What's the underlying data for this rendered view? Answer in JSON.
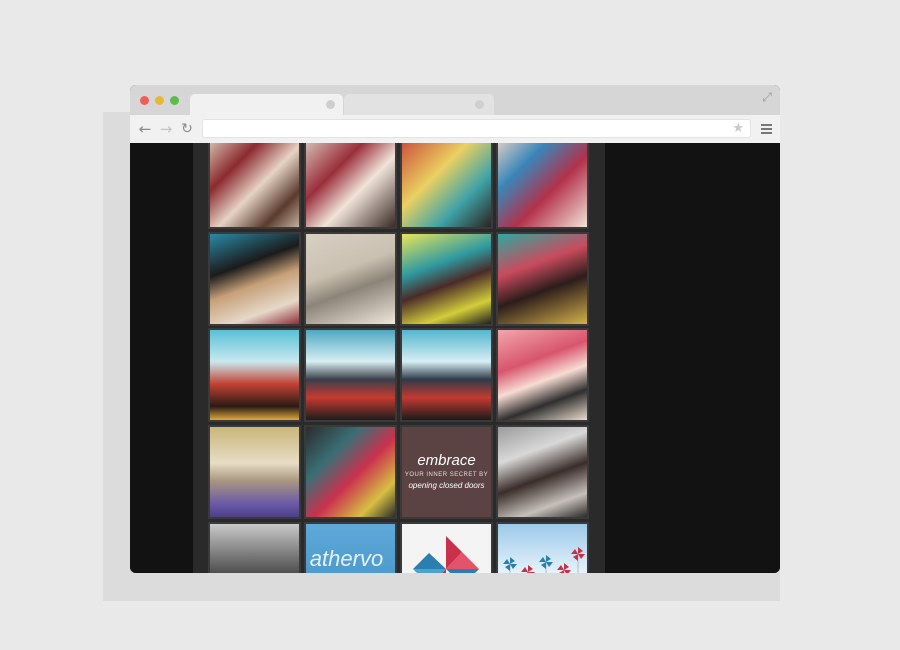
{
  "browser": {
    "url": "",
    "tabs": [
      {
        "title": "",
        "active": true
      },
      {
        "title": "",
        "active": false
      }
    ]
  },
  "gallery": {
    "tiles": [
      {
        "style": "linear-gradient(135deg,#d9c9b6 0%,#8b2a2e 30%,#e6d3c4 55%,#5a3b2e 80%,#c2b09f 100%)"
      },
      {
        "style": "linear-gradient(135deg,#d8c9bb 0%,#9a2f3b 35%,#f0e4da 60%,#3b2a26 100%)"
      },
      {
        "style": "linear-gradient(135deg,#c84a3a 0%,#ead061 40%,#3fa3a8 70%,#2d2320 100%)"
      },
      {
        "style": "linear-gradient(135deg,#e5d3c6 0%,#3a86b8 30%,#b2314a 60%,#f1e4d8 100%)"
      },
      {
        "style": "linear-gradient(160deg,#2b8aa6 0%,#1b1b1b 35%,#c6a078 55%,#e6d8c9 80%,#8f2f39 100%)"
      },
      {
        "style": "linear-gradient(160deg,#d8d0c4 0%,#c9c0b1 40%,#8c8478 60%,#efe7da 100%)"
      },
      {
        "style": "linear-gradient(160deg,#e9e55a 0%,#2f9aa0 35%,#4a2b28 55%,#d3cd3a 80%,#1f1f1f 100%)"
      },
      {
        "style": "linear-gradient(160deg,#2fa8a0 0%,#c94b5d 35%,#2c1d1b 60%,#d4b14a 100%)"
      },
      {
        "style": "linear-gradient(180deg,#59c0d6 0%,#c8e9ef 35%,#c14233 60%,#2a1b14 85%,#e0a83c 100%)"
      },
      {
        "style": "linear-gradient(180deg,#4ea9c3 0%,#d7eef2 35%,#3a3f4a 55%,#c53a2f 75%,#1d1d1d 100%)"
      },
      {
        "style": "linear-gradient(180deg,#54b6cd 0%,#d6eef4 35%,#2e3b48 55%,#c33a31 75%,#1b1b1b 100%)"
      },
      {
        "style": "linear-gradient(160deg,#f2a6ab 0%,#d7556d 35%,#f7dcd3 55%,#2f2f2f 75%,#ebdccd 100%)"
      },
      {
        "style": "linear-gradient(180deg,#c9b67a 0%,#e7ddc5 40%,#a89580 60%,#6b5aa8 85%,#4b3f86 100%)"
      },
      {
        "style": "linear-gradient(135deg,#2b2b2b 0%,#3a6f75 30%,#c9314d 55%,#d6c043 80%,#2b2b2b 100%)"
      },
      {
        "style": "#5a4342",
        "caption": {
          "title": "embrace",
          "line2": "YOUR INNER SECRET BY",
          "line3": "opening closed doors"
        }
      },
      {
        "style": "linear-gradient(160deg,#9b9b9b 0%,#d8d8d8 30%,#3a2d2a 55%,#c7c0ba 80%,#2a2a2a 100%)"
      },
      {
        "style": "linear-gradient(180deg,#c9c9c9 0%,#6e6e6e 40%,#2c2c2c 70%,#8f8f8f 100%)"
      },
      {
        "style": "linear-gradient(180deg,#5ea9d8 0%,#4b98cc 65%,#ffffff 100%)",
        "caption": {
          "title": "athervo"
        }
      },
      {
        "style": "#f4f4f4",
        "pinwheel": true
      },
      {
        "style": "linear-gradient(180deg,#9cc9e9 0%,#d9ecf7 45%,#ffffff 75%,#f4f4f4 100%)",
        "pinwheels_small": true
      }
    ]
  }
}
